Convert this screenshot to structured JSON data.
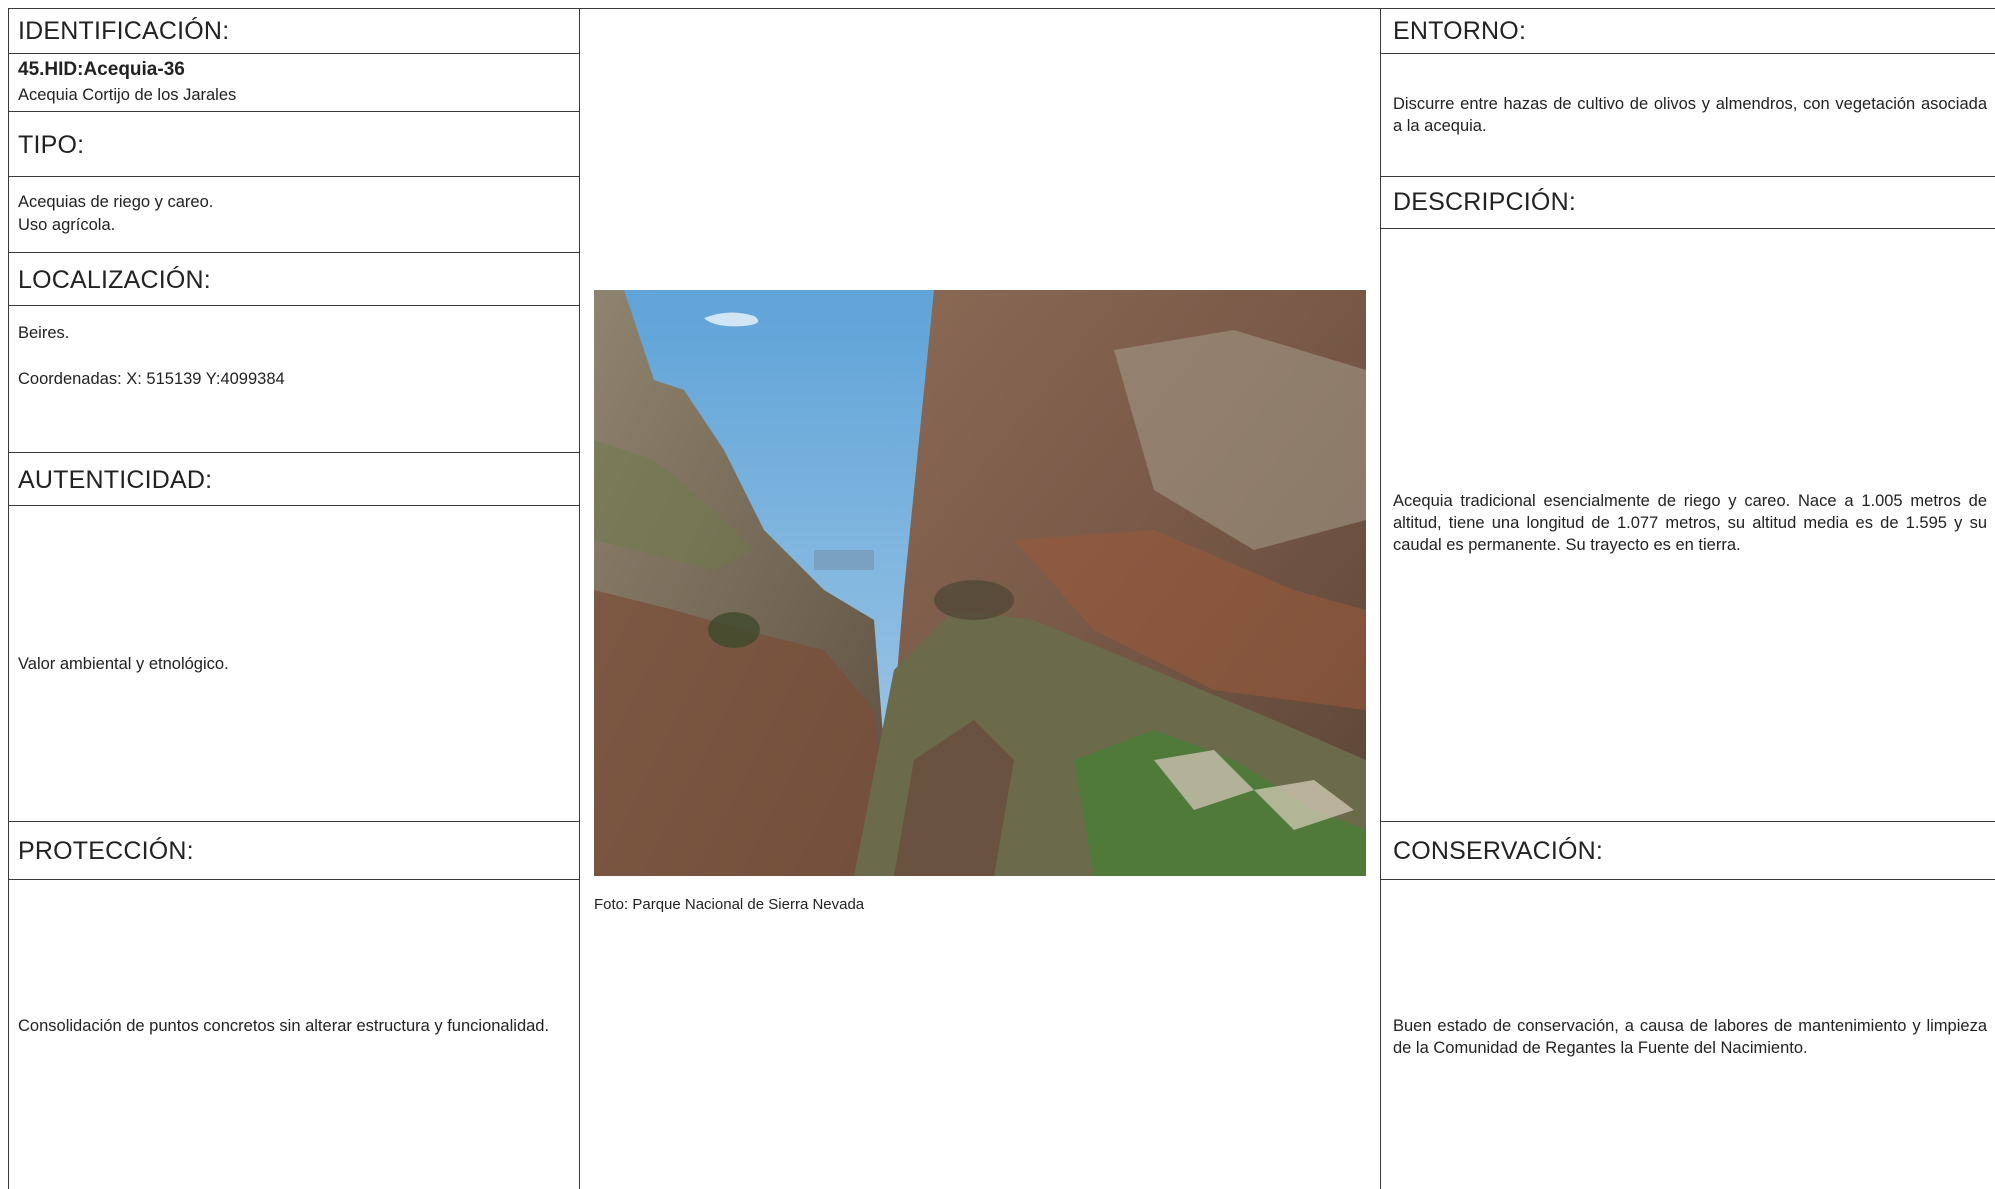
{
  "left": {
    "identificacion": {
      "heading": "IDENTIFICACIÓN:",
      "code": "45.HID:Acequia-36",
      "name": "Acequia Cortijo de los Jarales"
    },
    "tipo": {
      "heading": "TIPO:",
      "line1": "Acequias de riego y careo.",
      "line2": "Uso agrícola."
    },
    "localizacion": {
      "heading": "LOCALIZACIÓN:",
      "place": "Beires.",
      "coords": "Coordenadas: X: 515139 Y:4099384"
    },
    "autenticidad": {
      "heading": "AUTENTICIDAD:",
      "text": "Valor ambiental y etnológico."
    },
    "proteccion": {
      "heading": "PROTECCIÓN:",
      "text": "Consolidación de puntos concretos sin alterar estructura y funcionalidad."
    }
  },
  "center": {
    "photo_caption": "Foto: Parque Nacional de Sierra Nevada"
  },
  "right": {
    "entorno": {
      "heading": "ENTORNO:",
      "text": "Discurre entre hazas de cultivo de olivos y almendros, con vegetación asociada a la acequia."
    },
    "descripcion": {
      "heading": "DESCRIPCIÓN:",
      "text": "Acequia tradicional esencialmente de riego y careo. Nace a 1.005 metros de altitud, tiene una longitud de 1.077 metros, su altitud media es de 1.595 y su caudal es permanente. Su trayecto es en tierra."
    },
    "conservacion": {
      "heading": "CONSERVACIÓN:",
      "text": "Buen estado de conservación, a causa de labores de mantenimiento y limpieza de la Comunidad de Regantes la Fuente del Nacimiento."
    }
  }
}
